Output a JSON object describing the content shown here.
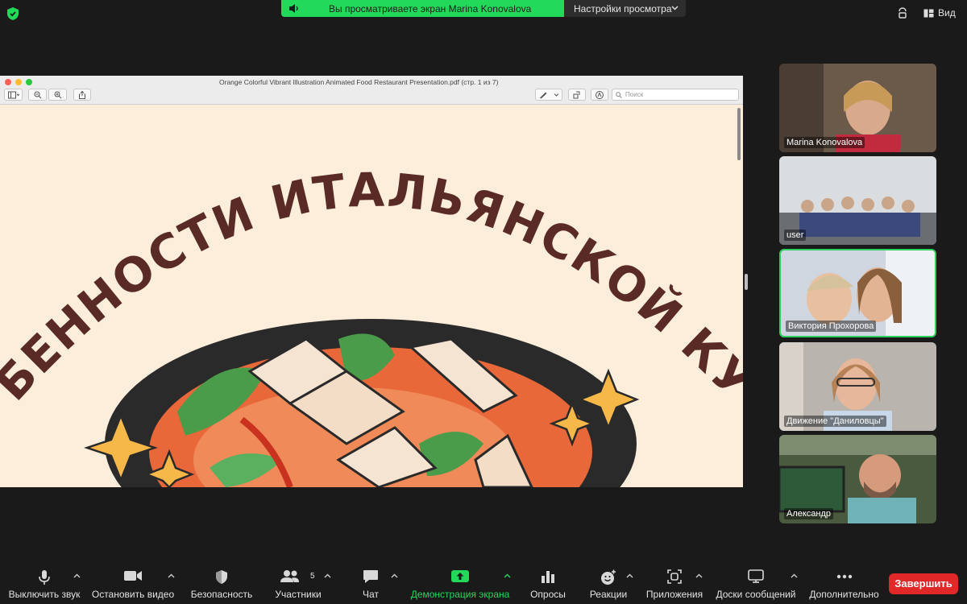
{
  "top": {
    "banner_text": "Вы просматриваете экран Marina Konovalova",
    "view_options_label": "Настройки просмотра",
    "view_label": "Вид"
  },
  "shared_window": {
    "doc_title": "Orange Colorful Vibrant Illustration Animated Food Restaurant Presentation.pdf (стр. 1 из 7)",
    "search_placeholder": "Поиск",
    "slide_heading": "ОСОБЕННОСТИ ИТАЛЬЯНСКОЙ КУХНИ"
  },
  "participants": [
    {
      "name": "Marina Konovalova"
    },
    {
      "name": "user"
    },
    {
      "name": "Виктория Прохорова"
    },
    {
      "name": "Движение \"Даниловцы\""
    },
    {
      "name": "Александр"
    }
  ],
  "toolbar": {
    "mute": "Выключить звук",
    "stop_video": "Остановить видео",
    "security": "Безопасность",
    "participants": "Участники",
    "participants_count": "5",
    "chat": "Чат",
    "share_screen": "Демонстрация экрана",
    "polls": "Опросы",
    "reactions": "Реакции",
    "apps": "Приложения",
    "whiteboards": "Доски сообщений",
    "more": "Дополнительно",
    "end": "Завершить"
  },
  "colors": {
    "accent_green": "#23d959",
    "end_red": "#e02828",
    "slide_bg": "#fdeedb",
    "slide_text": "#5a2a26"
  }
}
